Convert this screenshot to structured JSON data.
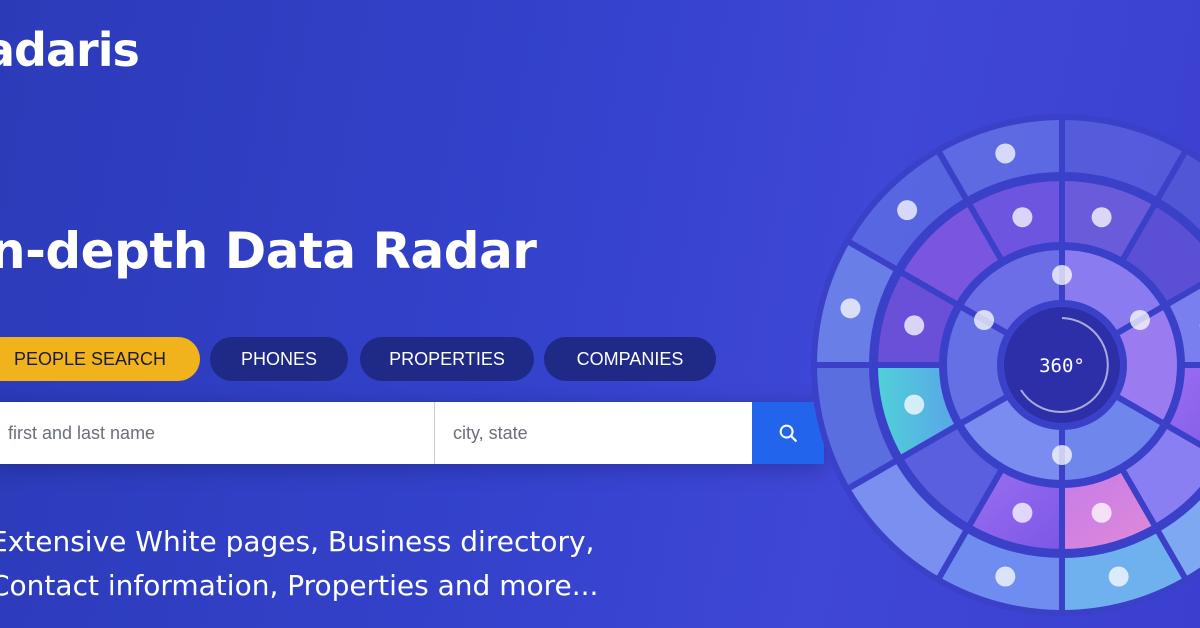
{
  "brand": {
    "logo_text": "adaris"
  },
  "hero": {
    "headline": "n-depth Data Radar",
    "tagline_line1": "Extensive White pages, Business directory,",
    "tagline_line2": "Contact information, Properties and more..."
  },
  "tabs": [
    {
      "label": "PEOPLE SEARCH",
      "active": true
    },
    {
      "label": "PHONES",
      "active": false
    },
    {
      "label": "PROPERTIES",
      "active": false
    },
    {
      "label": "COMPANIES",
      "active": false
    }
  ],
  "search": {
    "name_placeholder": "first and last name",
    "location_placeholder": "city, state",
    "button_icon": "search-icon"
  },
  "radar": {
    "center_label": "360°",
    "icons": [
      "person-search-icon",
      "more-icon",
      "location-pin-icon",
      "handcuffs-icon",
      "checklist-icon",
      "briefcase-icon",
      "chat-icon",
      "phone-icon",
      "users-icon",
      "image-icon",
      "person-search-icon",
      "mail-icon",
      "tie-icon",
      "scales-icon",
      "building-icon",
      "phone-question-icon",
      "heart-icon"
    ]
  },
  "colors": {
    "accent_yellow": "#f1b31c",
    "tab_dark": "#1e2a86",
    "search_button": "#2265ec",
    "background": "#3442cc"
  }
}
